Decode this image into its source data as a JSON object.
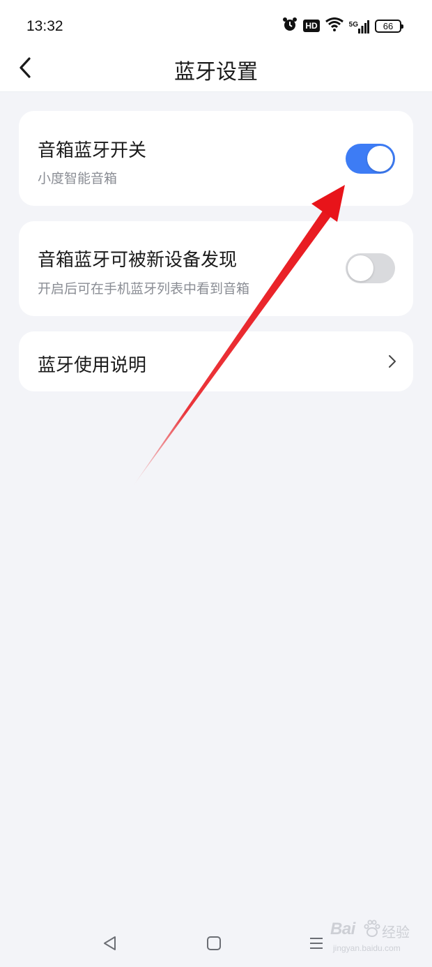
{
  "status_bar": {
    "time": "13:32",
    "icons": [
      "alarm-icon",
      "hd-icon",
      "wifi-icon",
      "signal-5g-icon",
      "battery-icon"
    ],
    "hd_label": "HD",
    "network_label": "5G",
    "battery_level": "66"
  },
  "header": {
    "back_icon": "chevron-left-icon",
    "title": "蓝牙设置"
  },
  "settings": [
    {
      "title": "音箱蓝牙开关",
      "subtitle": "小度智能音箱",
      "toggle_on": true
    },
    {
      "title": "音箱蓝牙可被新设备发现",
      "subtitle": "开启后可在手机蓝牙列表中看到音箱",
      "toggle_on": false
    },
    {
      "title": "蓝牙使用说明",
      "icon": "chevron-right-icon"
    }
  ],
  "annotation": {
    "type": "arrow",
    "color": "#e8141a"
  },
  "nav_bar": {
    "buttons": [
      "back-triangle-icon",
      "home-square-icon",
      "menu-lines-icon"
    ]
  },
  "watermark": {
    "logo": "Bai",
    "brand": "经验",
    "url": "jingyan.baidu.com"
  },
  "colors": {
    "background": "#f3f4f8",
    "card": "#ffffff",
    "toggle_on": "#3d7cf5",
    "toggle_off": "#d9dadd",
    "subtitle": "#8a8d94"
  }
}
